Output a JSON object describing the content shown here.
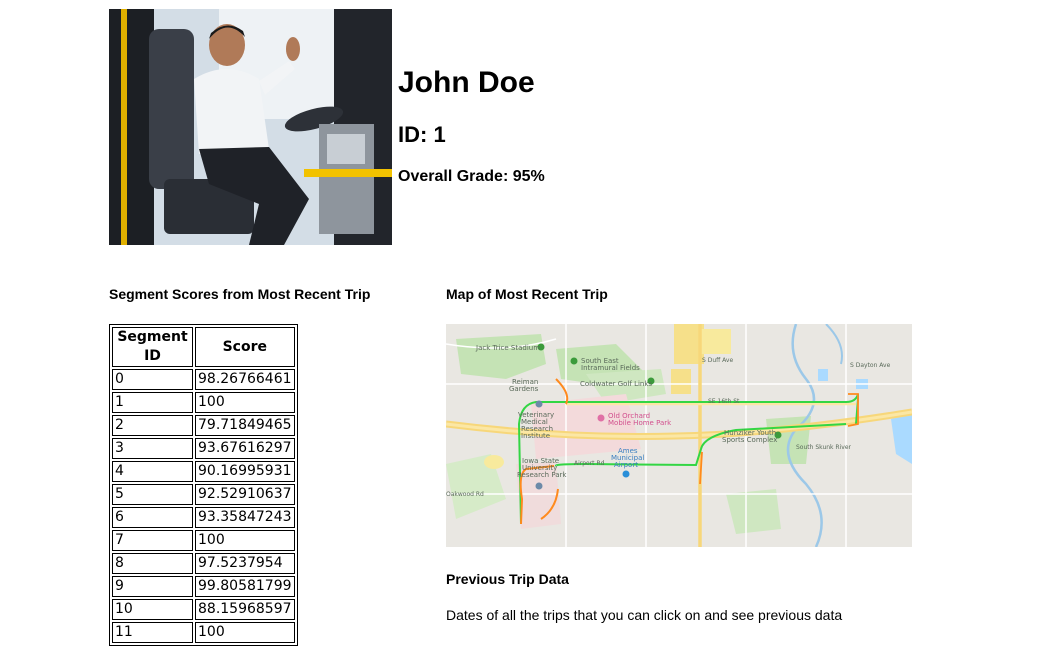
{
  "profile": {
    "name": "John Doe",
    "id_text": "ID: 1",
    "grade_text": "Overall Grade: 95%"
  },
  "segments": {
    "heading": "Segment Scores from Most Recent Trip",
    "columns": [
      "Segment ID",
      "Score"
    ],
    "rows": [
      [
        "0",
        "98.26766461"
      ],
      [
        "1",
        "100"
      ],
      [
        "2",
        "79.71849465"
      ],
      [
        "3",
        "93.67616297"
      ],
      [
        "4",
        "90.16995931"
      ],
      [
        "5",
        "92.52910637"
      ],
      [
        "6",
        "93.35847243"
      ],
      [
        "7",
        "100"
      ],
      [
        "8",
        "97.5237954"
      ],
      [
        "9",
        "99.80581799"
      ],
      [
        "10",
        "88.15968597"
      ],
      [
        "11",
        "100"
      ]
    ]
  },
  "map": {
    "heading": "Map of Most Recent Trip",
    "labels": {
      "jack_trice": "Jack Trice Stadium",
      "south_east": "South East",
      "intramural": "Intramural Fields",
      "reiman": "Reiman",
      "gardens": "Gardens",
      "coldwater": "Coldwater Golf Links",
      "vet1": "Veterinary",
      "vet2": "Medical",
      "vet3": "Research",
      "vet4": "Institute",
      "old_orchard1": "Old Orchard",
      "old_orchard2": "Mobile Home Park",
      "hunziker1": "Hunziker Youth",
      "hunziker2": "Sports Complex",
      "ames1": "Ames",
      "ames2": "Municipal",
      "ames3": "Airport",
      "isu1": "Iowa State",
      "isu2": "University",
      "isu3": "Research Park",
      "airport_rd": "Airport Rd",
      "se16": "SE 16th St",
      "s_duff": "S Duff Ave",
      "s_dayton": "S Dayton Ave",
      "south_skunk": "South Skunk River",
      "oakwood": "Oakwood Rd"
    }
  },
  "previous": {
    "heading": "Previous Trip Data",
    "description": "Dates of all the trips that you can click on and see previous data"
  }
}
